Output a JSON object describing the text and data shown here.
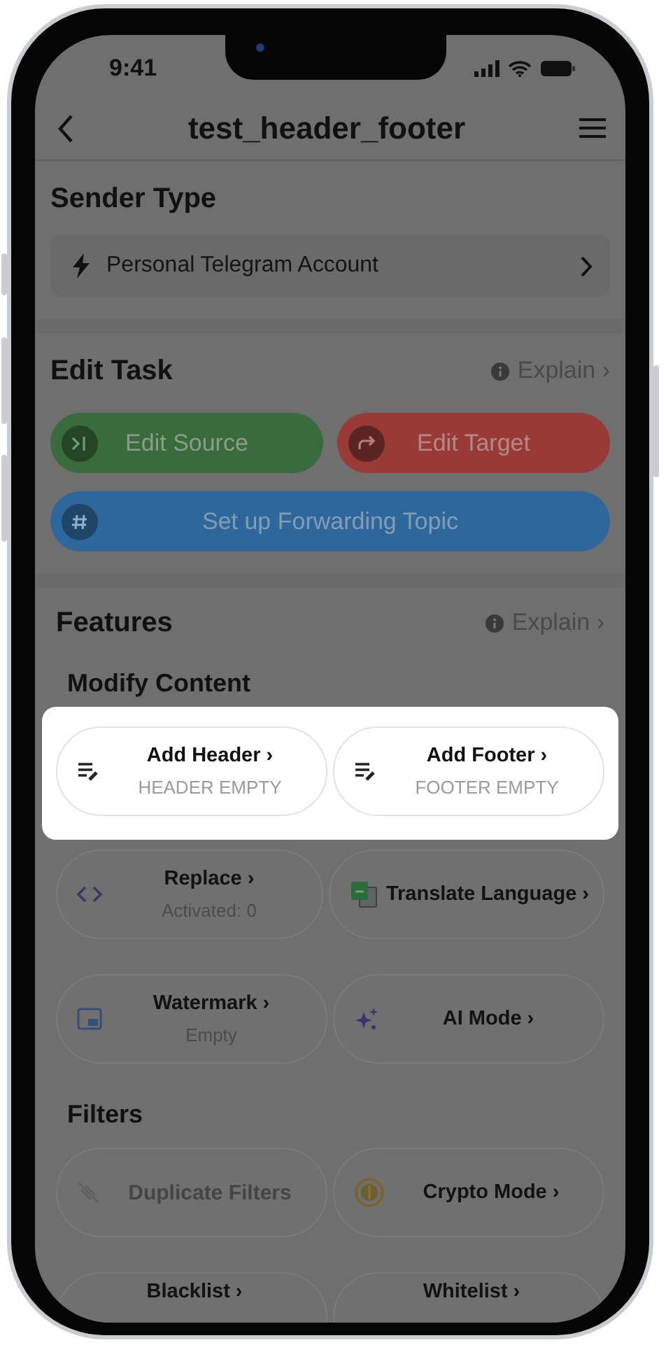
{
  "status_bar": {
    "time": "9:41"
  },
  "nav": {
    "title": "test_header_footer"
  },
  "sender_type": {
    "title": "Sender Type",
    "value": "Personal Telegram Account"
  },
  "edit_task": {
    "title": "Edit Task",
    "explain": "Explain ›",
    "buttons": [
      {
        "label": "Edit Source",
        "kind": "source",
        "color": "#3a6b3c"
      },
      {
        "label": "Edit Target",
        "kind": "target",
        "color": "#9a3a37"
      },
      {
        "label": "Set up Forwarding Topic",
        "kind": "topic",
        "color": "#2e679b"
      }
    ]
  },
  "features": {
    "title": "Features",
    "explain": "Explain ›",
    "groups": [
      {
        "title": "Modify Content",
        "rows": [
          {
            "highlighted": true,
            "cards": [
              {
                "title": "Add Header ›",
                "subtitle": "HEADER EMPTY",
                "kind": "header",
                "disabled": false
              },
              {
                "title": "Add Footer ›",
                "subtitle": "FOOTER EMPTY",
                "kind": "footer",
                "disabled": false
              }
            ]
          },
          {
            "highlighted": false,
            "cards": [
              {
                "title": "Replace ›",
                "subtitle": "Activated: 0",
                "kind": "replace",
                "disabled": false
              },
              {
                "title": "Translate Language ›",
                "kind": "translate",
                "disabled": false
              }
            ]
          },
          {
            "highlighted": false,
            "cards": [
              {
                "title": "Watermark ›",
                "subtitle": "Empty",
                "kind": "watermark",
                "disabled": false
              },
              {
                "title": "AI Mode ›",
                "kind": "ai",
                "disabled": false
              }
            ]
          }
        ]
      },
      {
        "title": "Filters",
        "rows": [
          {
            "highlighted": false,
            "cards": [
              {
                "title": "Duplicate Filters",
                "kind": "duplicate",
                "disabled": true
              },
              {
                "title": "Crypto Mode ›",
                "kind": "crypto",
                "disabled": false
              }
            ]
          },
          {
            "highlighted": false,
            "cards": [
              {
                "title": "Blacklist ›",
                "kind": "blacklist",
                "disabled": false
              },
              {
                "title": "Whitelist ›",
                "kind": "whitelist",
                "disabled": false
              }
            ]
          }
        ]
      }
    ]
  }
}
